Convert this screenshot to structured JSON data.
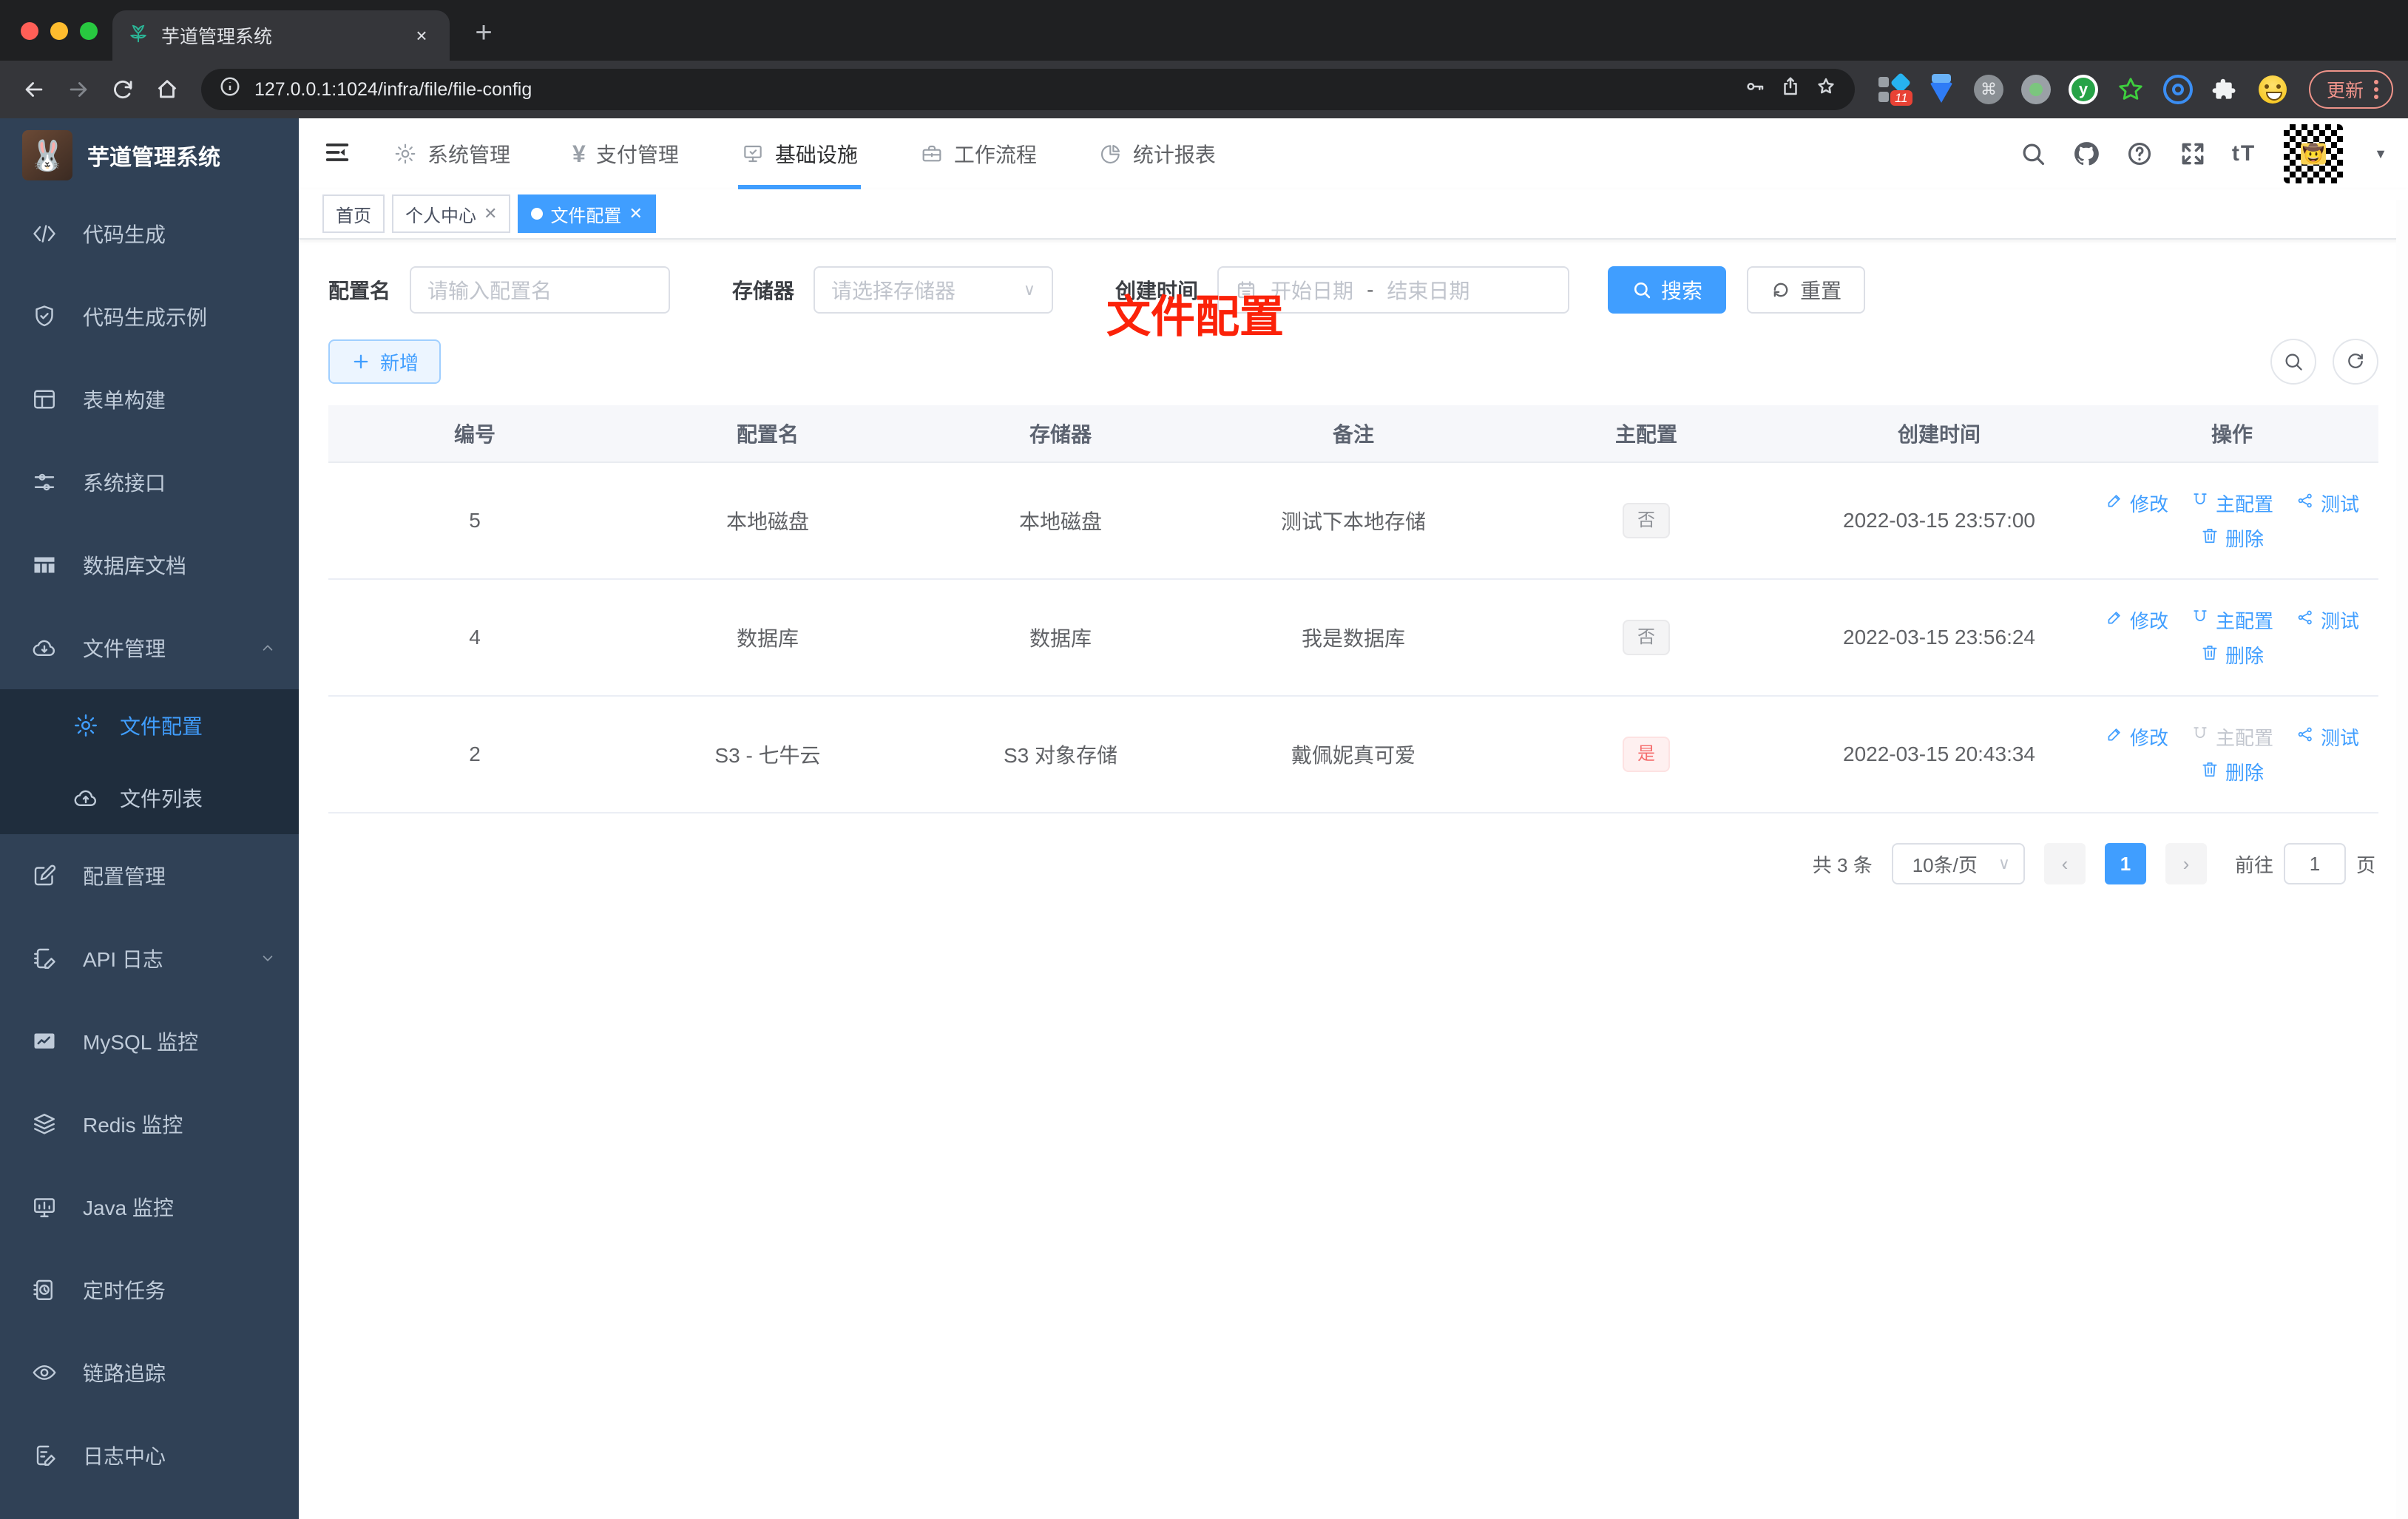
{
  "browser": {
    "tab_title": "芋道管理系统",
    "close_tab": "×",
    "new_tab": "+",
    "url": "127.0.0.1:1024/infra/file/file-config",
    "ext_badge": "11",
    "ext_y_letter": "y",
    "update_label": "更新"
  },
  "sidebar": {
    "title": "芋道管理系统",
    "items": [
      {
        "label": "代码生成",
        "icon": "code-icon"
      },
      {
        "label": "代码生成示例",
        "icon": "shield-check-icon"
      },
      {
        "label": "表单构建",
        "icon": "form-icon"
      },
      {
        "label": "系统接口",
        "icon": "sliders-icon"
      },
      {
        "label": "数据库文档",
        "icon": "table-icon"
      },
      {
        "label": "文件管理",
        "icon": "cloud-download-icon",
        "expand": "up",
        "children": [
          {
            "label": "文件配置",
            "icon": "gear-icon",
            "active": true
          },
          {
            "label": "文件列表",
            "icon": "cloud-upload-icon"
          }
        ]
      },
      {
        "label": "配置管理",
        "icon": "edit-square-icon"
      },
      {
        "label": "API 日志",
        "icon": "note-edit-icon",
        "expand": "down"
      },
      {
        "label": "MySQL 监控",
        "icon": "chart-monitor-icon"
      },
      {
        "label": "Redis 监控",
        "icon": "layers-icon"
      },
      {
        "label": "Java 监控",
        "icon": "monitor-icon"
      },
      {
        "label": "定时任务",
        "icon": "timer-icon"
      },
      {
        "label": "链路追踪",
        "icon": "eye-icon"
      },
      {
        "label": "日志中心",
        "icon": "log-edit-icon"
      }
    ]
  },
  "header": {
    "nav": [
      {
        "label": "系统管理",
        "icon": "gear-icon"
      },
      {
        "label": "支付管理",
        "icon": "yen-icon"
      },
      {
        "label": "基础设施",
        "icon": "monitor-check-icon",
        "active": true
      },
      {
        "label": "工作流程",
        "icon": "briefcase-icon"
      },
      {
        "label": "统计报表",
        "icon": "pie-chart-icon"
      }
    ],
    "text_size_label": "tT"
  },
  "tags": [
    {
      "label": "首页"
    },
    {
      "label": "个人中心",
      "closable": true
    },
    {
      "label": "文件配置",
      "closable": true,
      "active": true
    }
  ],
  "page_title": "文件配置",
  "filters": {
    "name_label": "配置名",
    "name_placeholder": "请输入配置名",
    "storage_label": "存储器",
    "storage_placeholder": "请选择存储器",
    "date_label": "创建时间",
    "date_start_placeholder": "开始日期",
    "date_separator": "-",
    "date_end_placeholder": "结束日期",
    "search_label": "搜索",
    "reset_label": "重置"
  },
  "toolbar": {
    "add_label": "新增"
  },
  "table": {
    "columns": [
      "编号",
      "配置名",
      "存储器",
      "备注",
      "主配置",
      "创建时间",
      "操作"
    ],
    "action_labels": {
      "edit": "修改",
      "master": "主配置",
      "test": "测试",
      "delete": "删除"
    },
    "rows": [
      {
        "id": "5",
        "name": "本地磁盘",
        "storage": "本地磁盘",
        "remark": "测试下本地存储",
        "master": "否",
        "master_type": "info",
        "created": "2022-03-15 23:57:00",
        "master_action_disabled": false
      },
      {
        "id": "4",
        "name": "数据库",
        "storage": "数据库",
        "remark": "我是数据库",
        "master": "否",
        "master_type": "info",
        "created": "2022-03-15 23:56:24",
        "master_action_disabled": false
      },
      {
        "id": "2",
        "name": "S3 - 七牛云",
        "storage": "S3 对象存储",
        "remark": "戴佩妮真可爱",
        "master": "是",
        "master_type": "danger",
        "created": "2022-03-15 20:43:34",
        "master_action_disabled": true
      }
    ]
  },
  "pagination": {
    "total": "共 3 条",
    "page_size": "10条/页",
    "prev": "‹",
    "page": "1",
    "next": "›",
    "goto_label": "前往",
    "goto_value": "1",
    "unit_label": "页"
  },
  "colors": {
    "accent": "#409eff",
    "danger": "#f56c6c",
    "sidebar_bg": "#304156",
    "submenu_bg": "#1f2d3d",
    "title_red": "#fb2209",
    "tab_tag_gray_bg": "#f4f4f5",
    "tab_tag_red_bg": "#fef0f0"
  }
}
